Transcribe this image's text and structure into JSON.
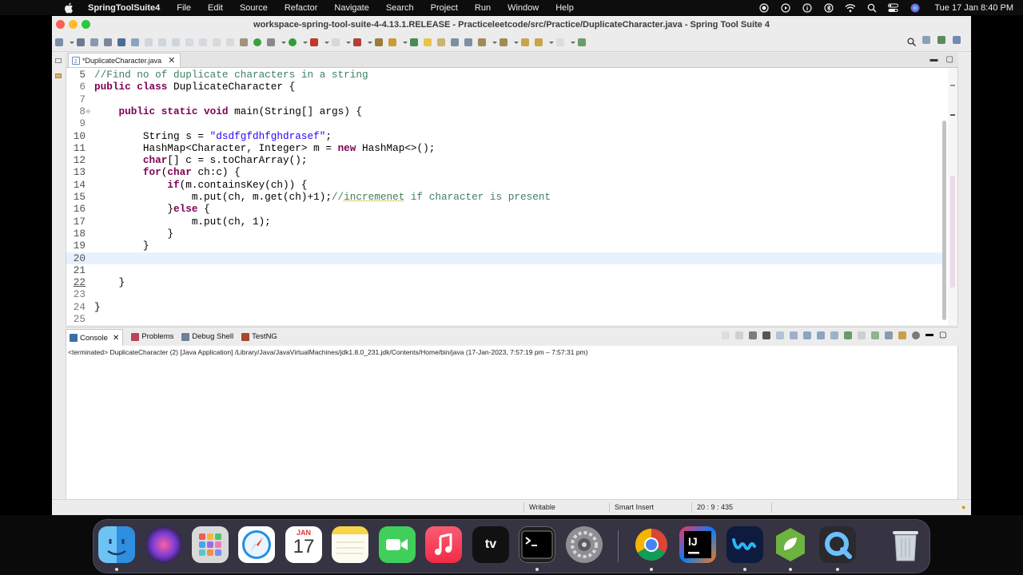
{
  "menubar": {
    "app_name": "SpringToolSuite4",
    "items": [
      "File",
      "Edit",
      "Source",
      "Refactor",
      "Navigate",
      "Search",
      "Project",
      "Run",
      "Window",
      "Help"
    ],
    "datetime": "Tue 17 Jan  8:40 PM"
  },
  "window": {
    "title": "workspace-spring-tool-suite-4-4.13.1.RELEASE - Practiceleetcode/src/Practice/DuplicateCharacter.java - Spring Tool Suite 4"
  },
  "editor": {
    "tab_label": "*DuplicateCharacter.java",
    "lines": [
      {
        "no": "5",
        "text": "//Find no of duplicate characters in a string"
      },
      {
        "no": "6",
        "text": "public class DuplicateCharacter {"
      },
      {
        "no": "7",
        "text": ""
      },
      {
        "no": "8",
        "text": "    public static void main(String[] args) {"
      },
      {
        "no": "9",
        "text": ""
      },
      {
        "no": "10",
        "text": "        String s = \"dsdfgfdhfghdrasef\";"
      },
      {
        "no": "11",
        "text": "        HashMap<Character, Integer> m = new HashMap<>();"
      },
      {
        "no": "12",
        "text": "        char[] c = s.toCharArray();"
      },
      {
        "no": "13",
        "text": "        for(char ch:c) {"
      },
      {
        "no": "14",
        "text": "            if(m.containsKey(ch)) {"
      },
      {
        "no": "15",
        "text": "                m.put(ch, m.get(ch)+1);//incremenet if character is present"
      },
      {
        "no": "16",
        "text": "            }else {"
      },
      {
        "no": "17",
        "text": "                m.put(ch, 1);"
      },
      {
        "no": "18",
        "text": "            }"
      },
      {
        "no": "19",
        "text": "        }"
      },
      {
        "no": "20",
        "text": ""
      },
      {
        "no": "21",
        "text": ""
      },
      {
        "no": "22",
        "text": "    }"
      },
      {
        "no": "23",
        "text": ""
      },
      {
        "no": "24",
        "text": "}"
      },
      {
        "no": "25",
        "text": ""
      }
    ],
    "current_line": "20"
  },
  "console": {
    "tabs": [
      "Console",
      "Problems",
      "Debug Shell",
      "TestNG"
    ],
    "terminated_text": "<terminated> DuplicateCharacter (2) [Java Application] /Library/Java/JavaVirtualMachines/jdk1.8.0_231.jdk/Contents/Home/bin/java  (17-Jan-2023, 7:57:19 pm – 7:57:31 pm)"
  },
  "statusbar": {
    "writable": "Writable",
    "insert_mode": "Smart Insert",
    "position": "20 : 9 : 435"
  },
  "dock": {
    "calendar_month": "JAN",
    "calendar_day": "17",
    "apps": [
      "finder",
      "siri",
      "launchpad",
      "safari",
      "calendar",
      "notes",
      "facetime",
      "music",
      "apple-tv",
      "terminal",
      "system-preferences",
      "chrome",
      "intellij",
      "webex",
      "spring-tool-suite",
      "quicktime",
      "trash"
    ]
  },
  "colors": {
    "keyword": "#7f0055",
    "string": "#2a00ff",
    "comment": "#3f7f5f",
    "current_line": "#e8f2fe"
  }
}
